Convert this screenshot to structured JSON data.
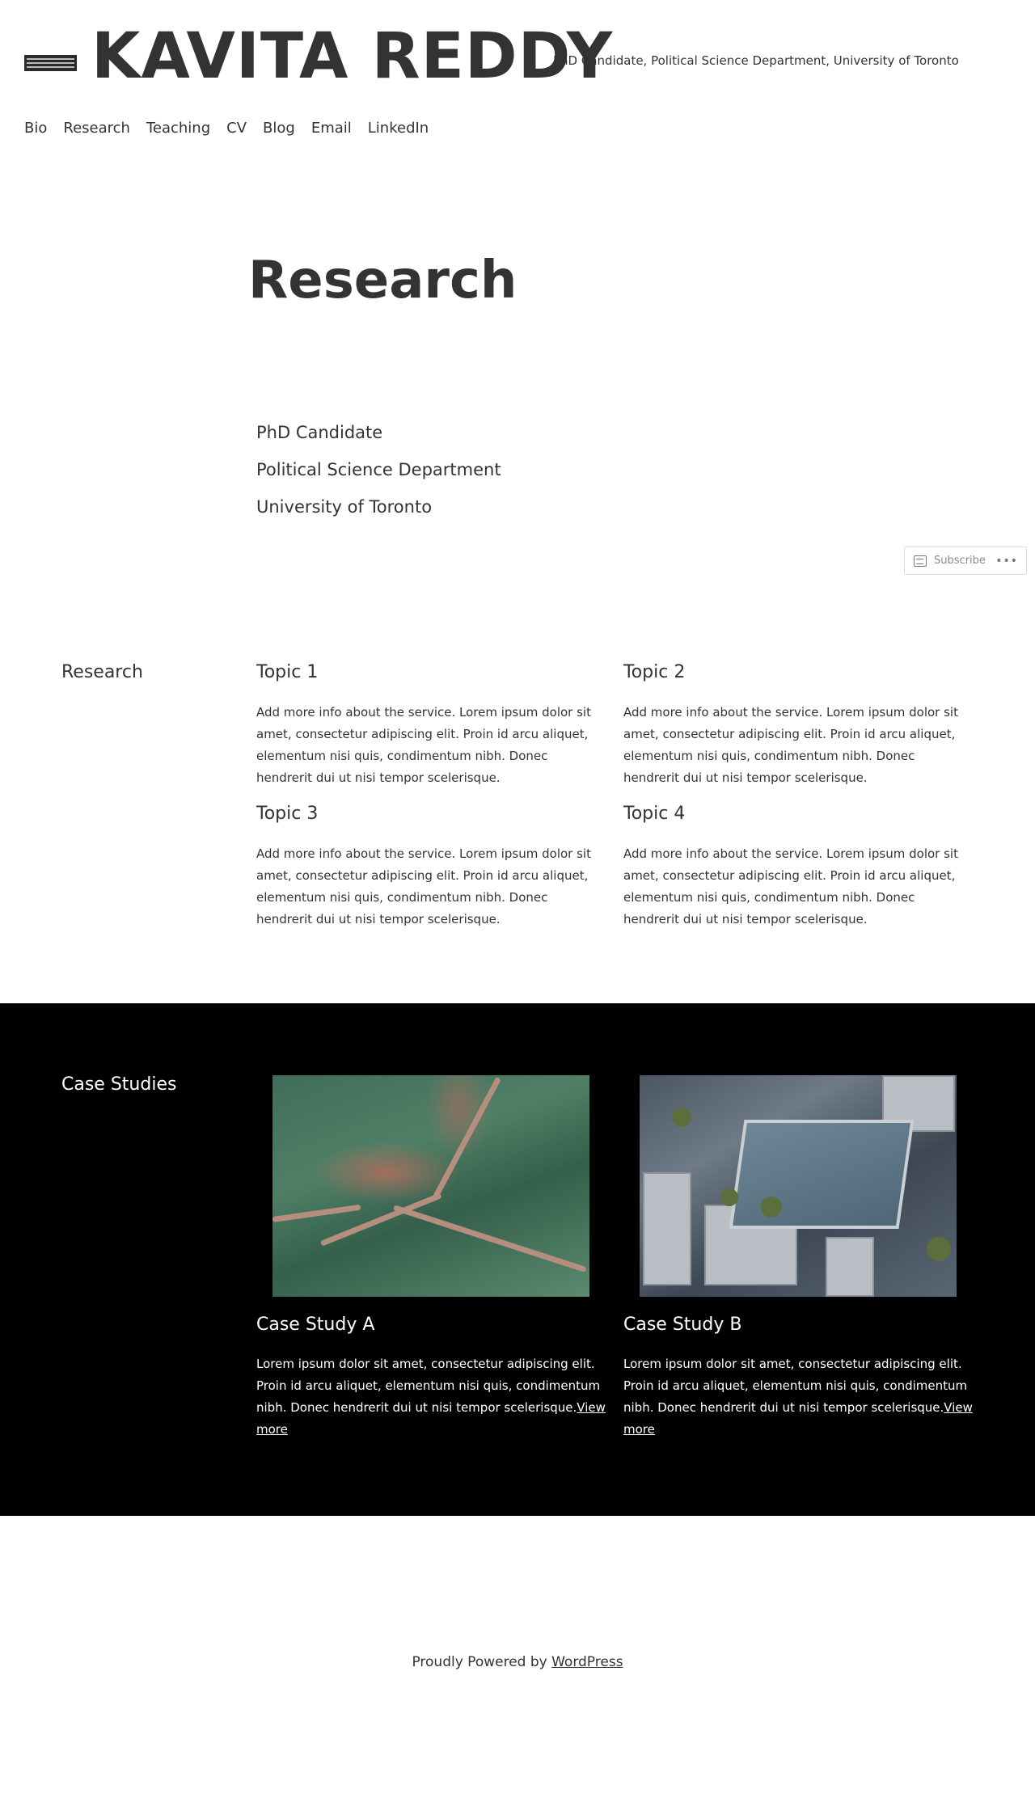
{
  "site": {
    "title": "KAVITA REDDY",
    "tagline": "PhD Candidate, Political Science Department, University of Toronto"
  },
  "nav": [
    "Bio",
    "Research",
    "Teaching",
    "CV",
    "Blog",
    "Email",
    "LinkedIn"
  ],
  "page": {
    "title": "Research",
    "intro": [
      "PhD Candidate",
      "Political Science Department",
      "University of Toronto"
    ]
  },
  "subscribe": {
    "label": "Subscribe",
    "more": "•••"
  },
  "research": {
    "label": "Research",
    "topics": [
      {
        "title": "Topic 1",
        "text": "Add more info about the service. Lorem ipsum dolor sit amet, consectetur adipiscing elit. Proin id arcu aliquet, elementum nisi quis, condimentum nibh. Donec hendrerit dui ut nisi tempor scelerisque."
      },
      {
        "title": "Topic 2",
        "text": "Add more info about the service. Lorem ipsum dolor sit amet, consectetur adipiscing elit. Proin id arcu aliquet, elementum nisi quis, condimentum nibh. Donec hendrerit dui ut nisi tempor scelerisque."
      },
      {
        "title": "Topic 3",
        "text": "Add more info about the service. Lorem ipsum dolor sit amet, consectetur adipiscing elit. Proin id arcu aliquet, elementum nisi quis, condimentum nibh. Donec hendrerit dui ut nisi tempor scelerisque."
      },
      {
        "title": "Topic 4",
        "text": "Add more info about the service. Lorem ipsum dolor sit amet, consectetur adipiscing elit. Proin id arcu aliquet, elementum nisi quis, condimentum nibh. Donec hendrerit dui ut nisi tempor scelerisque."
      }
    ]
  },
  "cases": {
    "label": "Case Studies",
    "items": [
      {
        "title": "Case Study A",
        "text": "Lorem ipsum dolor sit amet, consectetur adipiscing elit. Proin id arcu aliquet, elementum nisi quis, condimentum nibh. Donec hendrerit dui ut nisi tempor scelerisque.",
        "link": "View more"
      },
      {
        "title": "Case Study B",
        "text": "Lorem ipsum dolor sit amet, consectetur adipiscing elit. Proin id arcu aliquet, elementum nisi quis, condimentum nibh. Donec hendrerit dui ut nisi tempor scelerisque.",
        "link": "View more"
      }
    ]
  },
  "footer": {
    "text": "Proudly Powered by ",
    "link": "WordPress"
  },
  "colors": {
    "text": "#333333",
    "band": "#000000",
    "background": "#ffffff"
  }
}
